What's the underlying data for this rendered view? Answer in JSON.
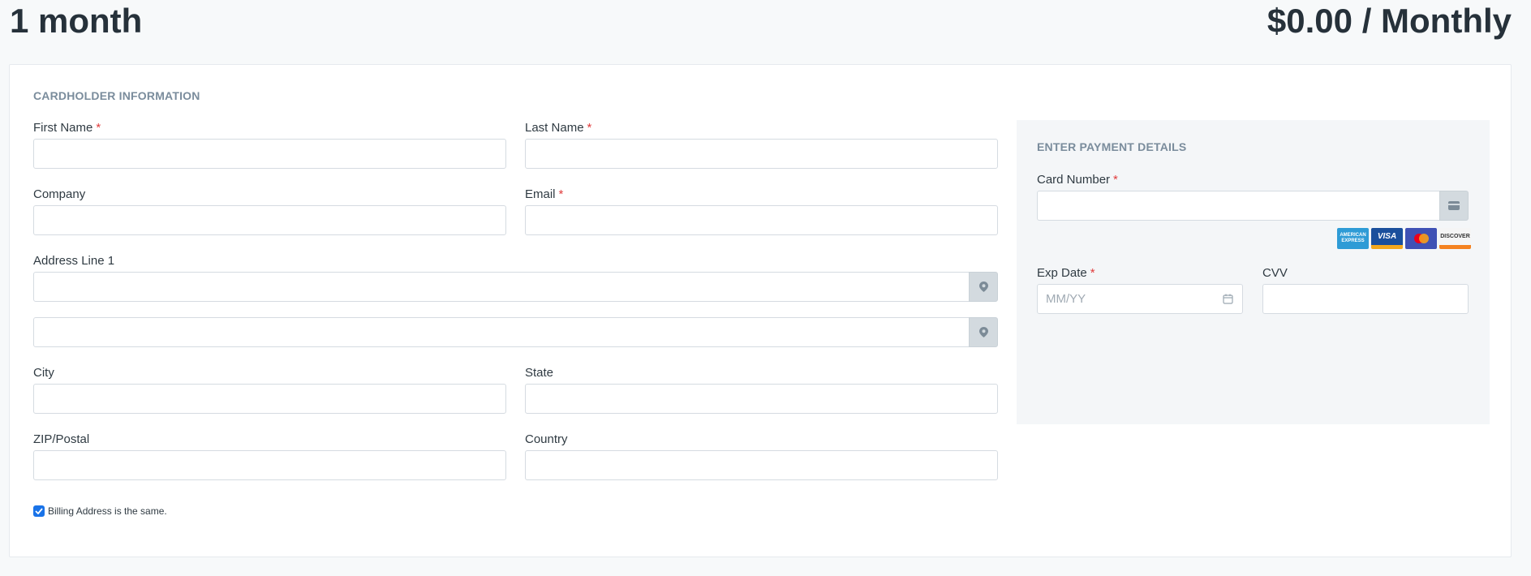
{
  "plan": {
    "term": "1 month",
    "price": "$0.00 / Monthly"
  },
  "cardholder": {
    "title": "CARDHOLDER INFORMATION",
    "fields": {
      "first_name": {
        "label": "First Name",
        "required": "*",
        "value": ""
      },
      "last_name": {
        "label": "Last Name",
        "required": "*",
        "value": ""
      },
      "company": {
        "label": "Company",
        "value": ""
      },
      "email": {
        "label": "Email",
        "required": "*",
        "value": ""
      },
      "address1": {
        "label": "Address Line 1",
        "value": ""
      },
      "address2": {
        "value": ""
      },
      "city": {
        "label": "City",
        "value": ""
      },
      "state": {
        "label": "State",
        "value": ""
      },
      "zip": {
        "label": "ZIP/Postal",
        "value": ""
      },
      "country": {
        "label": "Country",
        "value": ""
      }
    },
    "billing_same": {
      "label": "Billing Address is the same.",
      "checked": true
    }
  },
  "payment": {
    "title": "ENTER PAYMENT DETAILS",
    "card_number": {
      "label": "Card Number",
      "required": "*",
      "value": ""
    },
    "exp_date": {
      "label": "Exp Date",
      "required": "*",
      "placeholder": "MM/YY",
      "value": ""
    },
    "cvv": {
      "label": "CVV",
      "value": ""
    },
    "card_brands": [
      {
        "name": "american-express",
        "text": "AMERICAN EXPRESS",
        "color": "#2e9bd6"
      },
      {
        "name": "visa",
        "text": "VISA",
        "color": "#1a4f9c"
      },
      {
        "name": "mastercard",
        "text": "",
        "color": "#3f51b5"
      },
      {
        "name": "discover",
        "text": "DISCOVER",
        "color": "#f5f5f5"
      }
    ]
  },
  "colors": {
    "accent": "#1a73e8",
    "required": "#e03c3c",
    "section_title": "#7a8c9c"
  }
}
